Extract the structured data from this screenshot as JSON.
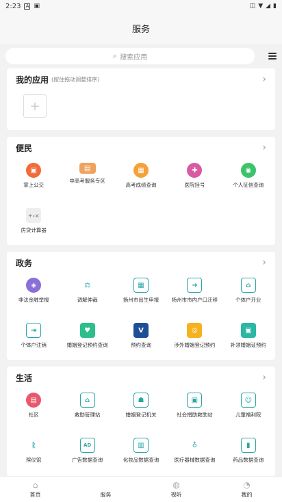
{
  "status_bar": {
    "time": "2:23",
    "icons_left": [
      "notification-icon",
      "sim-icon"
    ],
    "icons_right": [
      "vibrate-icon",
      "wifi-icon",
      "signal-icon",
      "battery-icon"
    ]
  },
  "header": {
    "title": "服务"
  },
  "search": {
    "placeholder": "搜索应用"
  },
  "my_apps": {
    "title": "我的应用",
    "hint": "(按住拖动调整排序)",
    "add_label": "+"
  },
  "sections": {
    "bianmin": {
      "title": "便民",
      "items": [
        {
          "label": "掌上公交",
          "icon": "bus-icon",
          "color": "#f26b3a"
        },
        {
          "label": "中高考服务专区",
          "icon": "exam-zone-icon",
          "color": "#f0a15e"
        },
        {
          "label": "高考成绩查询",
          "icon": "exam-score-icon",
          "color": "#f5a13a"
        },
        {
          "label": "医院挂号",
          "icon": "hospital-icon",
          "color": "#d95aa3"
        },
        {
          "label": "个人征信查询",
          "icon": "credit-icon",
          "color": "#3cc36b"
        },
        {
          "label": "房贷计算器",
          "icon": "calculator-icon",
          "color": "#cccccc"
        }
      ]
    },
    "zhengwu": {
      "title": "政务",
      "items": [
        {
          "label": "非法金融举报",
          "icon": "finance-report-icon",
          "color": "#8a6fd8"
        },
        {
          "label": "调解仲裁",
          "icon": "mediation-icon",
          "color": "#2aa6a6"
        },
        {
          "label": "扬州市出生申报",
          "icon": "birth-report-icon",
          "color": "#2aa6a6"
        },
        {
          "label": "扬州市市内户口迁移",
          "icon": "household-move-icon",
          "color": "#2aa6a6"
        },
        {
          "label": "个体户开业",
          "icon": "business-open-icon",
          "color": "#2aa6a6"
        },
        {
          "label": "个体户注销",
          "icon": "business-close-icon",
          "color": "#2aa6a6"
        },
        {
          "label": "婚姻登记预约查询",
          "icon": "marriage-query-icon",
          "color": "#2cbf8c"
        },
        {
          "label": "预约查询",
          "icon": "appointment-icon",
          "color": "#1e4f96"
        },
        {
          "label": "涉外婚姻登记预约",
          "icon": "foreign-marriage-icon",
          "color": "#f5b21e"
        },
        {
          "label": "补领婚姻证预约",
          "icon": "marriage-reissue-icon",
          "color": "#2ab7a4"
        }
      ]
    },
    "shenghuo": {
      "title": "生活",
      "items": [
        {
          "label": "社区",
          "icon": "community-icon",
          "color": "#e8596b"
        },
        {
          "label": "救助管理站",
          "icon": "rescue-station-icon",
          "color": "#2aa6a6"
        },
        {
          "label": "婚姻登记机关",
          "icon": "marriage-office-icon",
          "color": "#2aa6a6"
        },
        {
          "label": "社会捐助救助站",
          "icon": "donation-icon",
          "color": "#2aa6a6"
        },
        {
          "label": "儿童福利院",
          "icon": "child-welfare-icon",
          "color": "#2aa6a6"
        },
        {
          "label": "殡仪馆",
          "icon": "funeral-icon",
          "color": "#2aa6a6"
        },
        {
          "label": "广告数据查询",
          "icon": "ad-data-icon",
          "color": "#2aa6a6"
        },
        {
          "label": "化妆品数据查询",
          "icon": "cosmetics-icon",
          "color": "#2aa6a6"
        },
        {
          "label": "医疗器械数据查询",
          "icon": "medical-device-icon",
          "color": "#2aa6a6"
        },
        {
          "label": "药品数据查询",
          "icon": "medicine-icon",
          "color": "#2aa6a6"
        }
      ]
    }
  },
  "tabbar": [
    {
      "label": "首页",
      "icon": "home-icon"
    },
    {
      "label": "服务",
      "icon": "service-icon"
    },
    {
      "label": "视听",
      "icon": "media-icon"
    },
    {
      "label": "我的",
      "icon": "profile-icon"
    }
  ]
}
